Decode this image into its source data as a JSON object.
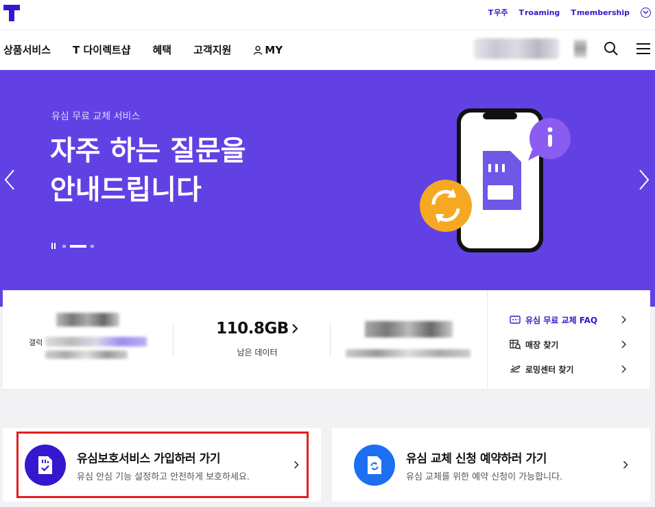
{
  "topbar": {
    "links": [
      {
        "prefix": "T",
        "label": "우주"
      },
      {
        "prefix": "T",
        "label": "roaming"
      },
      {
        "prefix": "T",
        "label": "membership"
      }
    ]
  },
  "nav": {
    "items": [
      "상품서비스",
      "T 다이렉트샵",
      "혜택",
      "고객지원"
    ],
    "my_label": "MY"
  },
  "hero": {
    "subtitle": "유심 무료 교체 서비스",
    "title": "자주 하는 질문을\n안내드립니다",
    "slides_total": 3,
    "active_slide": 2
  },
  "account": {
    "data_remaining": "110.8GB",
    "data_label": "남은 데이터",
    "partial_label": "갤럭"
  },
  "quick_links": [
    {
      "label": "유심 무료 교체 FAQ",
      "icon": "sim-list-icon"
    },
    {
      "label": "매장 찾기",
      "icon": "store-map-icon"
    },
    {
      "label": "로밍센터 찾기",
      "icon": "airplane-icon"
    }
  ],
  "cards": [
    {
      "title": "유심보호서비스 가입하러 가기",
      "desc": "유심 안심 기능 설정하고 안전하게 보호하세요.",
      "icon": "sim-check-icon"
    },
    {
      "title": "유심 교체 신청 예약하러 가기",
      "desc": "유심 교체를 위한 예약 신청이 가능합니다.",
      "icon": "sim-refresh-icon"
    }
  ],
  "colors": {
    "brand": "#3617ce",
    "hero_bg": "#6241e4",
    "highlight": "#e21d1d"
  }
}
